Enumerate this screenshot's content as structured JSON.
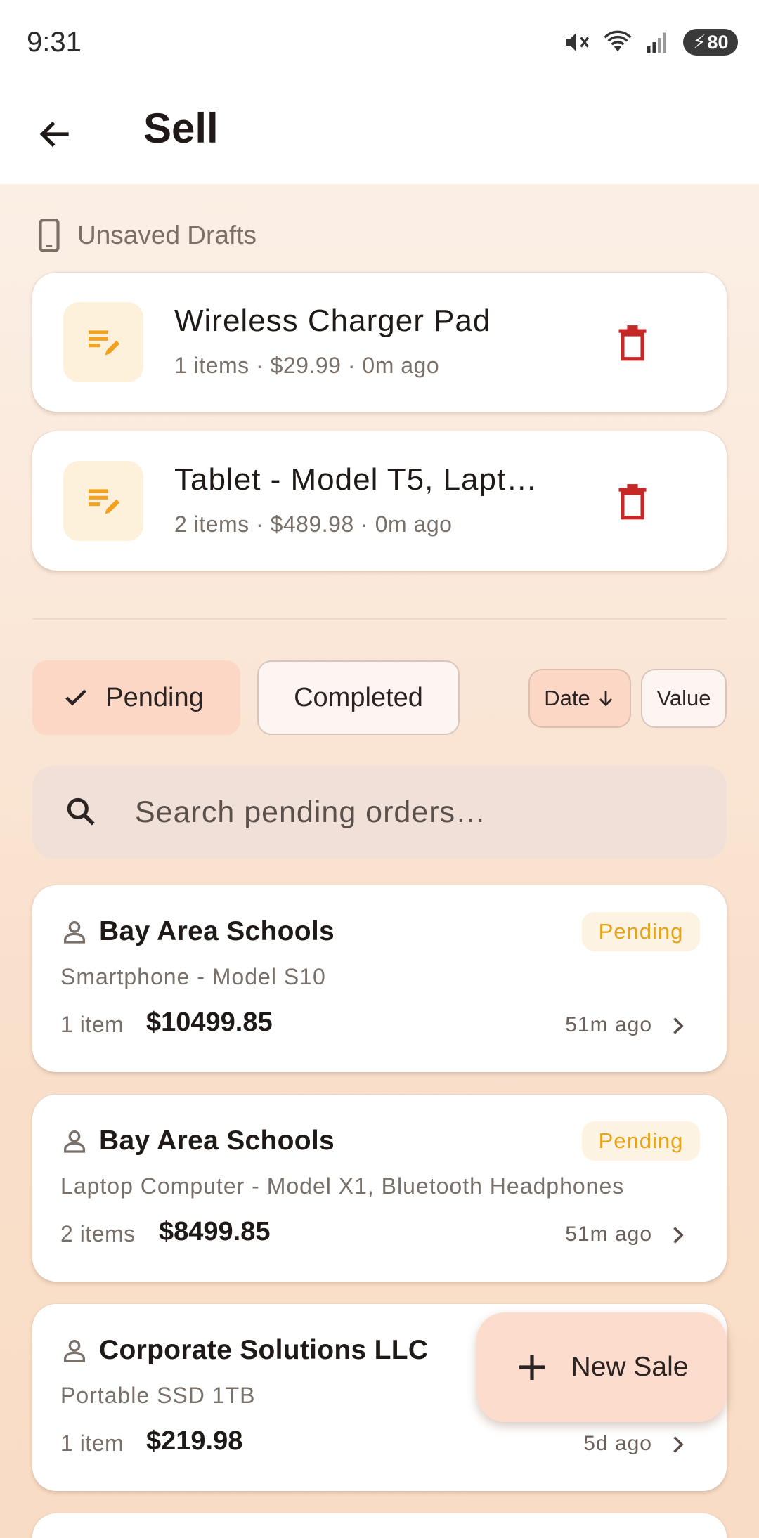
{
  "status_bar": {
    "time": "9:31",
    "battery": "80"
  },
  "app_bar": {
    "title": "Sell"
  },
  "drafts": {
    "header": "Unsaved Drafts",
    "items": [
      {
        "title": "Wireless Charger Pad",
        "meta": "1 items · $29.99 · 0m ago"
      },
      {
        "title": "Tablet - Model T5, Lapt…",
        "meta": "2 items · $489.98 · 0m ago"
      }
    ]
  },
  "filters": {
    "pending_label": "Pending",
    "completed_label": "Completed",
    "sort_date_label": "Date",
    "sort_value_label": "Value"
  },
  "search": {
    "placeholder": "Search pending orders…"
  },
  "orders": [
    {
      "customer": "Bay Area Schools",
      "status": "Pending",
      "items": "Smartphone - Model S10",
      "count": "1 item",
      "total": "$10499.85",
      "time": "51m ago"
    },
    {
      "customer": "Bay Area Schools",
      "status": "Pending",
      "items": "Laptop Computer - Model X1, Bluetooth Headphones",
      "count": "2 items",
      "total": "$8499.85",
      "time": "51m ago"
    },
    {
      "customer": "Corporate Solutions LLC",
      "status": "",
      "items": "Portable SSD 1TB",
      "count": "1 item",
      "total": "$219.98",
      "time": "5d ago"
    }
  ],
  "fab": {
    "label": "New Sale"
  },
  "colors": {
    "accent": "#fcd7c6",
    "pending_text": "#e7a21a",
    "delete": "#c62828",
    "draft_icon": "#f2a21e"
  },
  "icons": [
    "back-arrow-icon",
    "phone-icon",
    "draft-edit-icon",
    "trash-icon",
    "check-icon",
    "arrow-down-icon",
    "search-icon",
    "person-icon",
    "chevron-right-icon",
    "plus-icon"
  ]
}
